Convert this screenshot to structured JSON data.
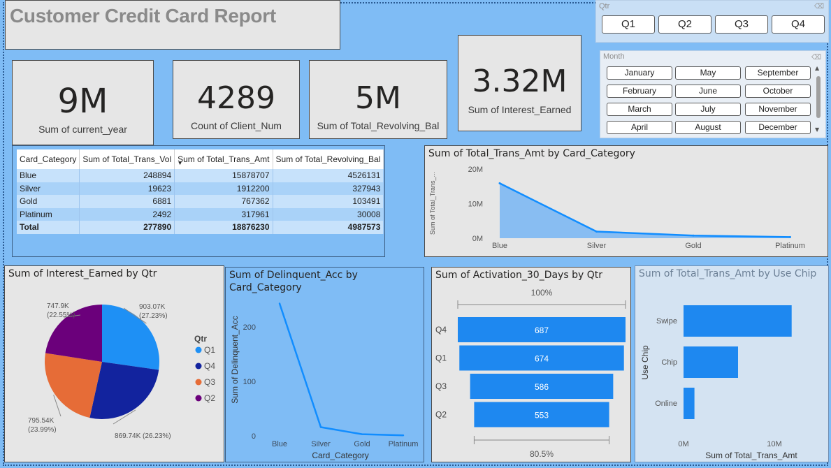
{
  "report_title": "Customer Credit Card Report",
  "kpis": {
    "current_year": {
      "value": "9M",
      "label": "Sum of current_year"
    },
    "client_num": {
      "value": "4289",
      "label": "Count of Client_Num"
    },
    "revolving_bal": {
      "value": "5M",
      "label": "Sum of Total_Revolving_Bal"
    },
    "interest_earned": {
      "value": "3.32M",
      "label": "Sum of Interest_Earned"
    }
  },
  "qtr_slicer": {
    "title": "Qtr",
    "options": [
      "Q1",
      "Q2",
      "Q3",
      "Q4"
    ]
  },
  "month_slicer": {
    "title": "Month",
    "options": [
      "January",
      "May",
      "September",
      "February",
      "June",
      "October",
      "March",
      "July",
      "November",
      "April",
      "August",
      "December"
    ]
  },
  "matrix": {
    "headers": [
      "Card_Category",
      "Sum of Total_Trans_Vol",
      "Sum of Total_Trans_Amt",
      "Sum of Total_Revolving_Bal"
    ],
    "rows": [
      [
        "Blue",
        "248894",
        "15878707",
        "4526131"
      ],
      [
        "Silver",
        "19623",
        "1912200",
        "327943"
      ],
      [
        "Gold",
        "6881",
        "767362",
        "103491"
      ],
      [
        "Platinum",
        "2492",
        "317961",
        "30008"
      ]
    ],
    "total": [
      "Total",
      "277890",
      "18876230",
      "4987573"
    ]
  },
  "colors": {
    "accent": "#118dff",
    "area_fill": "#88bdf2",
    "bar": "#1e88f0",
    "pie_q1": "#1e90f5",
    "pie_q4": "#12239e",
    "pie_q3": "#e66c37",
    "pie_q2": "#6b007b"
  },
  "chart_data": [
    {
      "id": "trans_amt_area",
      "type": "area",
      "title": "Sum of Total_Trans_Amt by Card_Category",
      "ylabel": "Sum of Total_Trans_...",
      "categories": [
        "Blue",
        "Silver",
        "Gold",
        "Platinum"
      ],
      "values": [
        15878707,
        1912200,
        767362,
        317961
      ],
      "ylim": [
        0,
        20000000
      ],
      "yticks": [
        "0M",
        "10M",
        "20M"
      ]
    },
    {
      "id": "interest_pie",
      "type": "pie",
      "title": "Sum of Interest_Earned by Qtr",
      "legend_title": "Qtr",
      "legend": [
        "Q1",
        "Q4",
        "Q3",
        "Q2"
      ],
      "slices": [
        {
          "name": "Q1",
          "value": 903.07,
          "label": "903.07K",
          "pct": "(27.23%)"
        },
        {
          "name": "Q4",
          "value": 869.74,
          "label": "869.74K (26.23%)",
          "pct": ""
        },
        {
          "name": "Q3",
          "value": 795.54,
          "label": "795.54K",
          "pct": "(23.99%)"
        },
        {
          "name": "Q2",
          "value": 747.9,
          "label": "747.9K",
          "pct": "(22.55%)"
        }
      ]
    },
    {
      "id": "delinquent_line",
      "type": "line",
      "title_line1": "Sum of Delinquent_Acc by",
      "title_line2": "Card_Category",
      "xlabel": "Card_Category",
      "ylabel": "Sum of Delinquent_Acc",
      "categories": [
        "Blue",
        "Silver",
        "Gold",
        "Platinum"
      ],
      "values": [
        243,
        16,
        3,
        1
      ],
      "ylim": [
        0,
        250
      ],
      "yticks": [
        "0",
        "100",
        "200"
      ]
    },
    {
      "id": "activation_funnel",
      "type": "bar",
      "title": "Sum of Activation_30_Days by Qtr",
      "categories": [
        "Q4",
        "Q1",
        "Q3",
        "Q2"
      ],
      "values": [
        687,
        674,
        586,
        553
      ],
      "top_label": "100%",
      "bottom_label": "80.5%"
    },
    {
      "id": "usechip_bar",
      "type": "bar",
      "title": "Sum of Total_Trans_Amt by Use Chip",
      "xlabel": "Sum of Total_Trans_Amt",
      "ylabel": "Use Chip",
      "categories": [
        "Swipe",
        "Chip",
        "Online"
      ],
      "values": [
        11900000,
        6000000,
        1200000
      ],
      "xlim": [
        0,
        12000000
      ],
      "xticks": [
        "0M",
        "10M"
      ]
    }
  ]
}
